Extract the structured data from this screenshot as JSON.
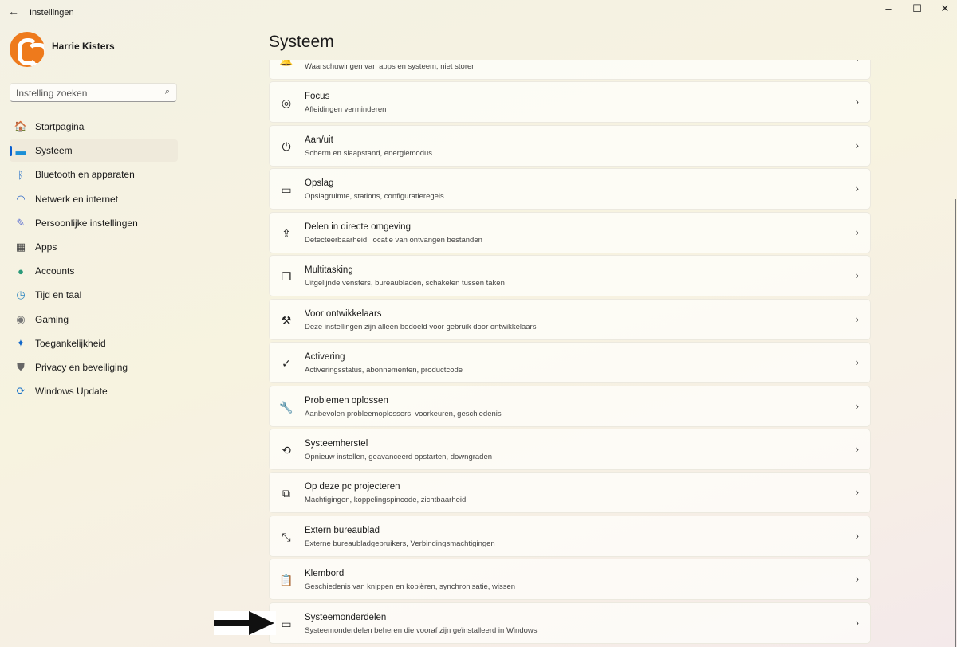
{
  "window": {
    "title": "Instellingen",
    "back_icon": "arrow-left-icon",
    "minimize": "–",
    "maximize": "☐",
    "close": "✕"
  },
  "user": {
    "name": "Harrie Kisters"
  },
  "search": {
    "placeholder": "Instelling zoeken",
    "icon": "search-icon"
  },
  "nav": {
    "items": [
      {
        "label": "Startpagina",
        "icon": "home-icon",
        "glyph": "🏠"
      },
      {
        "label": "Systeem",
        "icon": "system-icon",
        "glyph": "▬",
        "active": true
      },
      {
        "label": "Bluetooth en apparaten",
        "icon": "bluetooth-icon",
        "glyph": "ᛒ"
      },
      {
        "label": "Netwerk en internet",
        "icon": "wifi-icon",
        "glyph": "◠"
      },
      {
        "label": "Persoonlijke instellingen",
        "icon": "brush-icon",
        "glyph": "✎"
      },
      {
        "label": "Apps",
        "icon": "apps-icon",
        "glyph": "▦"
      },
      {
        "label": "Accounts",
        "icon": "person-icon",
        "glyph": "●"
      },
      {
        "label": "Tijd en taal",
        "icon": "clock-globe-icon",
        "glyph": "◷"
      },
      {
        "label": "Gaming",
        "icon": "gamepad-icon",
        "glyph": "◉"
      },
      {
        "label": "Toegankelijkheid",
        "icon": "accessibility-icon",
        "glyph": "✦"
      },
      {
        "label": "Privacy en beveiliging",
        "icon": "shield-icon",
        "glyph": "⛊"
      },
      {
        "label": "Windows Update",
        "icon": "update-icon",
        "glyph": "⟳"
      }
    ]
  },
  "page": {
    "title": "Systeem"
  },
  "cards": [
    {
      "title": "",
      "subtitle": "Waarschuwingen van apps en systeem, niet storen",
      "icon": "notifications-icon",
      "glyph": "🔔"
    },
    {
      "title": "Focus",
      "subtitle": "Afleidingen verminderen",
      "icon": "focus-icon",
      "glyph": "◎"
    },
    {
      "title": "Aan/uit",
      "subtitle": "Scherm en slaapstand, energiemodus",
      "icon": "power-icon",
      "glyph": "⏻"
    },
    {
      "title": "Opslag",
      "subtitle": "Opslagruimte, stations, configuratieregels",
      "icon": "storage-icon",
      "glyph": "▭"
    },
    {
      "title": "Delen in directe omgeving",
      "subtitle": "Detecteerbaarheid, locatie van ontvangen bestanden",
      "icon": "share-icon",
      "glyph": "⇪"
    },
    {
      "title": "Multitasking",
      "subtitle": "Uitgelijnde vensters, bureaubladen, schakelen tussen taken",
      "icon": "multitasking-icon",
      "glyph": "❐"
    },
    {
      "title": "Voor ontwikkelaars",
      "subtitle": "Deze instellingen zijn alleen bedoeld voor gebruik door ontwikkelaars",
      "icon": "developer-tools-icon",
      "glyph": "⚒"
    },
    {
      "title": "Activering",
      "subtitle": "Activeringsstatus, abonnementen, productcode",
      "icon": "check-circle-icon",
      "glyph": "✓"
    },
    {
      "title": "Problemen oplossen",
      "subtitle": "Aanbevolen probleemoplossers, voorkeuren, geschiedenis",
      "icon": "wrench-icon",
      "glyph": "🔧"
    },
    {
      "title": "Systeemherstel",
      "subtitle": "Opnieuw instellen, geavanceerd opstarten, downgraden",
      "icon": "recovery-icon",
      "glyph": "⟲"
    },
    {
      "title": "Op deze pc projecteren",
      "subtitle": "Machtigingen, koppelingspincode, zichtbaarheid",
      "icon": "project-icon",
      "glyph": "⧉"
    },
    {
      "title": "Extern bureaublad",
      "subtitle": "Externe bureaubladgebruikers, Verbindingsmachtigingen",
      "icon": "remote-desktop-icon",
      "glyph": "⤡"
    },
    {
      "title": "Klembord",
      "subtitle": "Geschiedenis van knippen en kopiëren, synchronisatie, wissen",
      "icon": "clipboard-icon",
      "glyph": "📋"
    },
    {
      "title": "Systeemonderdelen",
      "subtitle": "Systeemonderdelen beheren die vooraf zijn geïnstalleerd in Windows",
      "icon": "system-components-icon",
      "glyph": "▭"
    }
  ]
}
